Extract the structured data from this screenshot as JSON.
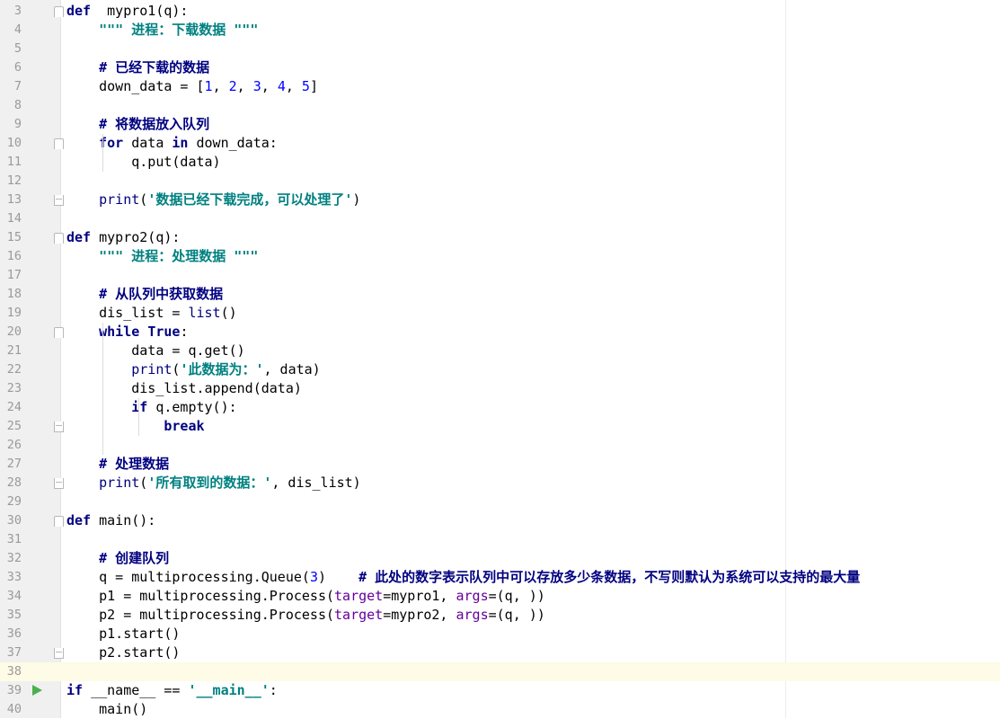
{
  "editor": {
    "current_line": 38,
    "lines": [
      {
        "n": "3",
        "fold": "open",
        "tokens": [
          [
            "kw",
            "def"
          ],
          [
            "",
            "  mypro1(q):"
          ]
        ]
      },
      {
        "n": "4",
        "tokens": [
          [
            "",
            "    "
          ],
          [
            "docs",
            "\"\"\" 进程：下载数据 \"\"\""
          ]
        ]
      },
      {
        "n": "5",
        "tokens": []
      },
      {
        "n": "6",
        "tokens": [
          [
            "",
            "    "
          ],
          [
            "cmt",
            "# 已经下载的数据"
          ]
        ]
      },
      {
        "n": "7",
        "tokens": [
          [
            "",
            "    down_data = ["
          ],
          [
            "num",
            "1"
          ],
          [
            "",
            ", "
          ],
          [
            "num",
            "2"
          ],
          [
            "",
            ", "
          ],
          [
            "num",
            "3"
          ],
          [
            "",
            ", "
          ],
          [
            "num",
            "4"
          ],
          [
            "",
            ", "
          ],
          [
            "num",
            "5"
          ],
          [
            "",
            "]"
          ]
        ]
      },
      {
        "n": "8",
        "tokens": []
      },
      {
        "n": "9",
        "tokens": [
          [
            "",
            "    "
          ],
          [
            "cmt",
            "# 将数据放入队列"
          ]
        ]
      },
      {
        "n": "10",
        "fold": "open",
        "tokens": [
          [
            "",
            "    "
          ],
          [
            "kw",
            "for"
          ],
          [
            "",
            " data "
          ],
          [
            "kw",
            "in"
          ],
          [
            "",
            " down_data:"
          ]
        ]
      },
      {
        "n": "11",
        "tokens": [
          [
            "",
            "        q.put(data)"
          ]
        ]
      },
      {
        "n": "12",
        "tokens": []
      },
      {
        "n": "13",
        "fold": "close",
        "tokens": [
          [
            "",
            "    "
          ],
          [
            "fn",
            "print"
          ],
          [
            "",
            "("
          ],
          [
            "str",
            "'数据已经下载完成，可以处理了'"
          ],
          [
            "",
            ")"
          ]
        ]
      },
      {
        "n": "14",
        "tokens": []
      },
      {
        "n": "15",
        "fold": "open",
        "tokens": [
          [
            "kw",
            "def"
          ],
          [
            "",
            " mypro2(q):"
          ]
        ]
      },
      {
        "n": "16",
        "tokens": [
          [
            "",
            "    "
          ],
          [
            "docs",
            "\"\"\" 进程：处理数据 \"\"\""
          ]
        ]
      },
      {
        "n": "17",
        "tokens": []
      },
      {
        "n": "18",
        "tokens": [
          [
            "",
            "    "
          ],
          [
            "cmt",
            "# 从队列中获取数据"
          ]
        ]
      },
      {
        "n": "19",
        "tokens": [
          [
            "",
            "    dis_list = "
          ],
          [
            "fn",
            "list"
          ],
          [
            "",
            "()"
          ]
        ]
      },
      {
        "n": "20",
        "fold": "open",
        "tokens": [
          [
            "",
            "    "
          ],
          [
            "kw",
            "while"
          ],
          [
            "",
            " "
          ],
          [
            "kw",
            "True"
          ],
          [
            "",
            ":"
          ]
        ]
      },
      {
        "n": "21",
        "tokens": [
          [
            "",
            "        data = q.get()"
          ]
        ]
      },
      {
        "n": "22",
        "tokens": [
          [
            "",
            "        "
          ],
          [
            "fn",
            "print"
          ],
          [
            "",
            "("
          ],
          [
            "str",
            "'此数据为：'"
          ],
          [
            "",
            ", data)"
          ]
        ]
      },
      {
        "n": "23",
        "tokens": [
          [
            "",
            "        dis_list.append(data)"
          ]
        ]
      },
      {
        "n": "24",
        "tokens": [
          [
            "",
            "        "
          ],
          [
            "kw",
            "if"
          ],
          [
            "",
            " q.empty():"
          ]
        ]
      },
      {
        "n": "25",
        "fold": "close",
        "tokens": [
          [
            "",
            "            "
          ],
          [
            "kw",
            "break"
          ]
        ]
      },
      {
        "n": "26",
        "tokens": []
      },
      {
        "n": "27",
        "tokens": [
          [
            "",
            "    "
          ],
          [
            "cmt",
            "# 处理数据"
          ]
        ]
      },
      {
        "n": "28",
        "fold": "close",
        "tokens": [
          [
            "",
            "    "
          ],
          [
            "fn",
            "print"
          ],
          [
            "",
            "("
          ],
          [
            "str",
            "'所有取到的数据：'"
          ],
          [
            "",
            ", dis_list)"
          ]
        ]
      },
      {
        "n": "29",
        "tokens": []
      },
      {
        "n": "30",
        "fold": "open",
        "tokens": [
          [
            "kw",
            "def"
          ],
          [
            "",
            " main():"
          ]
        ]
      },
      {
        "n": "31",
        "tokens": []
      },
      {
        "n": "32",
        "tokens": [
          [
            "",
            "    "
          ],
          [
            "cmt",
            "# 创建队列"
          ]
        ]
      },
      {
        "n": "33",
        "tokens": [
          [
            "",
            "    q = multiprocessing.Queue("
          ],
          [
            "num",
            "3"
          ],
          [
            "",
            ")    "
          ],
          [
            "cmt",
            "# 此处的数字表示队列中可以存放多少条数据，不写则默认为系统可以支持的最大量"
          ]
        ]
      },
      {
        "n": "34",
        "tokens": [
          [
            "",
            "    p1 = multiprocessing.Process("
          ],
          [
            "kwarg",
            "target"
          ],
          [
            "",
            "=mypro1, "
          ],
          [
            "kwarg",
            "args"
          ],
          [
            "",
            "=(q, ))"
          ]
        ]
      },
      {
        "n": "35",
        "tokens": [
          [
            "",
            "    p2 = multiprocessing.Process("
          ],
          [
            "kwarg",
            "target"
          ],
          [
            "",
            "=mypro2, "
          ],
          [
            "kwarg",
            "args"
          ],
          [
            "",
            "=(q, ))"
          ]
        ]
      },
      {
        "n": "36",
        "tokens": [
          [
            "",
            "    p1.start()"
          ]
        ]
      },
      {
        "n": "37",
        "fold": "close",
        "tokens": [
          [
            "",
            "    p2.start()"
          ]
        ]
      },
      {
        "n": "38",
        "tokens": []
      },
      {
        "n": "39",
        "run": true,
        "tokens": [
          [
            "kw",
            "if"
          ],
          [
            "",
            " __name__ == "
          ],
          [
            "dunder",
            "'__main__'"
          ],
          [
            "",
            ":"
          ]
        ]
      },
      {
        "n": "40",
        "tokens": [
          [
            "",
            "    main()"
          ]
        ]
      }
    ]
  }
}
